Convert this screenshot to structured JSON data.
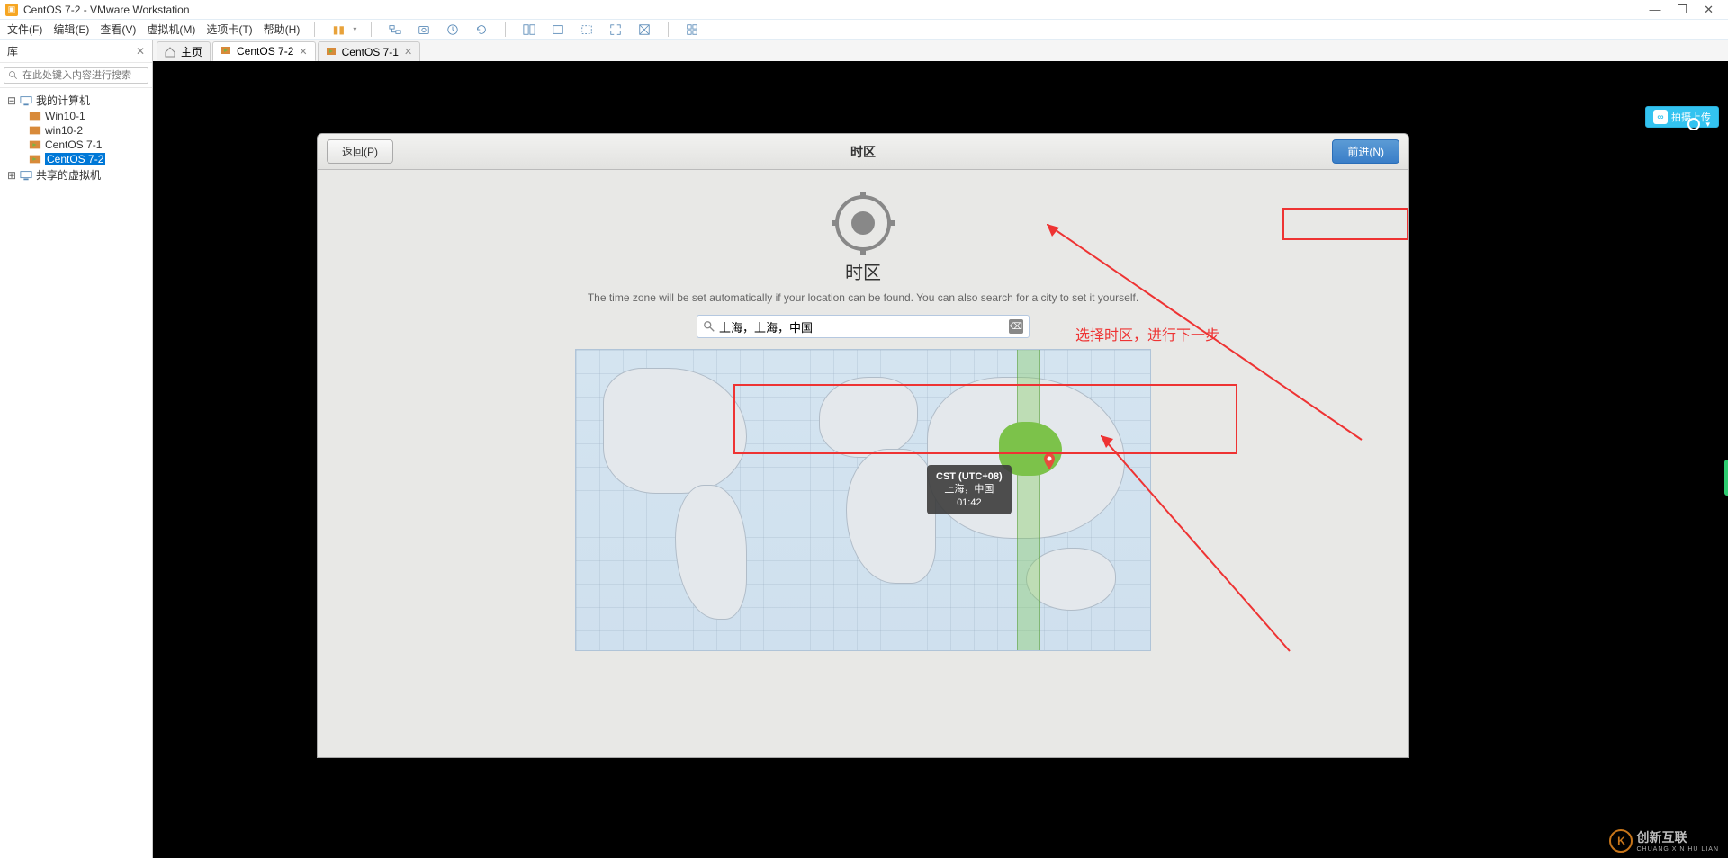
{
  "titlebar": {
    "title": "CentOS 7-2 - VMware Workstation"
  },
  "menubar": {
    "file": "文件(F)",
    "edit": "编辑(E)",
    "view": "查看(V)",
    "vm": "虚拟机(M)",
    "tabs": "选项卡(T)",
    "help": "帮助(H)"
  },
  "sidebar": {
    "header": "库",
    "search_placeholder": "在此处键入内容进行搜索",
    "root": "我的计算机",
    "items": [
      {
        "label": "Win10-1",
        "state": "off"
      },
      {
        "label": "win10-2",
        "state": "off"
      },
      {
        "label": "CentOS 7-1",
        "state": "on"
      },
      {
        "label": "CentOS 7-2",
        "state": "on",
        "selected": true
      }
    ],
    "shared": "共享的虚拟机"
  },
  "tabs": [
    {
      "label": "主页",
      "kind": "home"
    },
    {
      "label": "CentOS 7-2",
      "kind": "on",
      "active": true
    },
    {
      "label": "CentOS 7-1",
      "kind": "on"
    }
  ],
  "upload": {
    "label": "拍摄上传"
  },
  "installer": {
    "back": "返回(P)",
    "title": "时区",
    "forward": "前进(N)",
    "heading": "时区",
    "desc": "The time zone will be set automatically if your location can be found. You can also search for a city to set it yourself.",
    "search_value": "上海，上海，中国",
    "tooltip": {
      "l1": "CST (UTC+08)",
      "l2": "上海，中国",
      "l3": "01:42"
    }
  },
  "annotation": {
    "text": "选择时区，进行下一步"
  },
  "watermark": {
    "brand": "创新互联",
    "sub": "CHUANG XIN HU LIAN"
  }
}
